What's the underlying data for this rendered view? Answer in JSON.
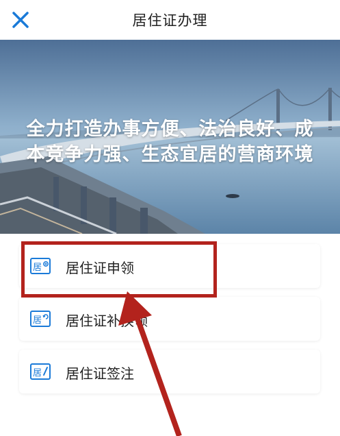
{
  "header": {
    "title": "居住证办理",
    "close_icon": "close-icon"
  },
  "banner": {
    "line1": "全力打造办事方便、法治良好、成",
    "line2": "本竞争力强、生态宜居的营商环境"
  },
  "menu": {
    "items": [
      {
        "label": "居住证申领",
        "icon_char": "居",
        "icon": "residence-apply-icon"
      },
      {
        "label": "居住证补换领",
        "icon_char": "居",
        "icon": "residence-replace-icon"
      },
      {
        "label": "居住证签注",
        "icon_char": "居",
        "icon": "residence-endorse-icon"
      }
    ]
  },
  "colors": {
    "accent": "#1a7ad8",
    "annotation": "#b3231d"
  }
}
